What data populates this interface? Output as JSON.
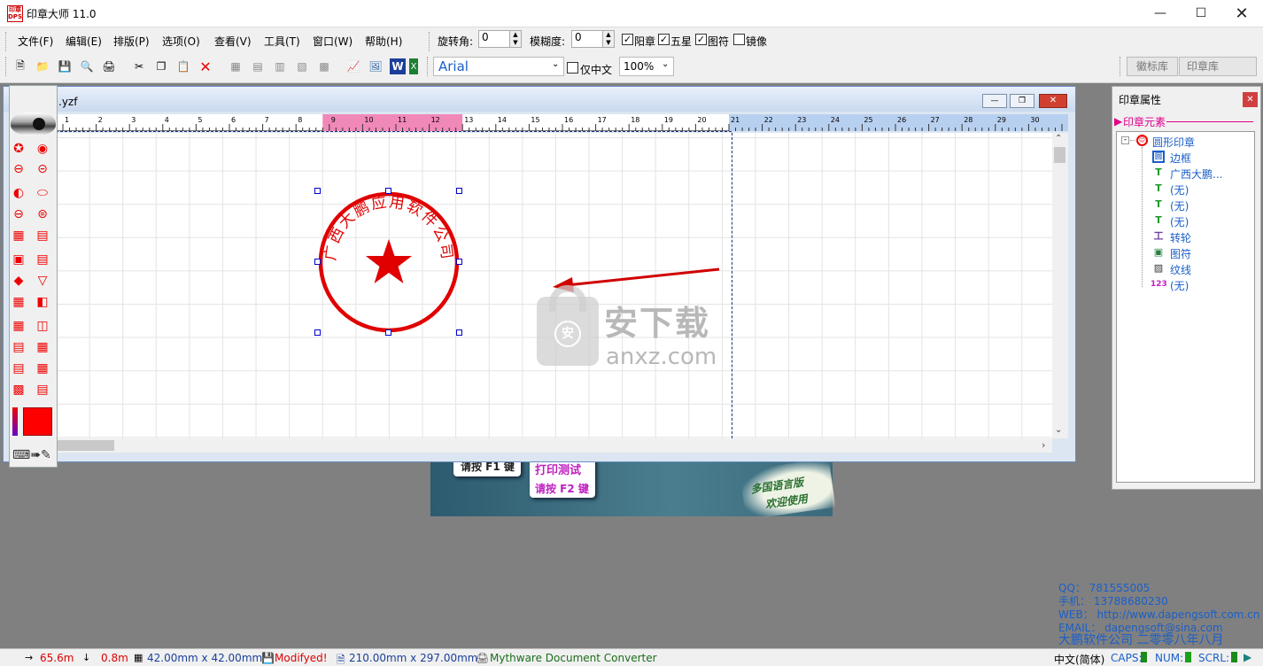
{
  "window": {
    "title": "印章大师 11.0",
    "app_icon_text": "印章\nDPS"
  },
  "menu": [
    "文件(F)",
    "编辑(E)",
    "排版(P)",
    "选项(O)",
    "查看(V)",
    "工具(T)",
    "窗口(W)",
    "帮助(H)"
  ],
  "rotation": {
    "label": "旋转角:",
    "value": "0"
  },
  "blur": {
    "label": "模糊度:",
    "value": "0"
  },
  "checks": [
    {
      "label": "阳章",
      "checked": true
    },
    {
      "label": "五星",
      "checked": true
    },
    {
      "label": "图符",
      "checked": true
    },
    {
      "label": "镜像",
      "checked": false
    }
  ],
  "font": {
    "value": "Arial"
  },
  "cn_only": {
    "label": "仅中文",
    "checked": false
  },
  "zoom": {
    "value": "100%"
  },
  "library_tabs": [
    "徽标库",
    "印章库"
  ],
  "document": {
    "filename": ".yzf"
  },
  "ruler": {
    "ticks": [
      "1",
      "2",
      "3",
      "4",
      "5",
      "6",
      "7",
      "8",
      "9",
      "10",
      "11",
      "12",
      "13",
      "14",
      "15",
      "16",
      "17",
      "18",
      "19",
      "20",
      "21",
      "22",
      "23",
      "24",
      "25",
      "26",
      "27",
      "28",
      "29",
      "30"
    ]
  },
  "seal": {
    "text": "广西大鹏应用软件公司",
    "color": "#e00000"
  },
  "watermark": {
    "cn": "安下载",
    "en": "anxz.com",
    "badge": "安"
  },
  "properties": {
    "title": "印章属性",
    "section": "印章元素",
    "tree": [
      {
        "icon": "seal-circle-icon",
        "label": "圆形印章"
      },
      {
        "icon": "border-icon",
        "label": "边框"
      },
      {
        "icon": "text-icon",
        "label": "广西大鹏..."
      },
      {
        "icon": "text2-icon",
        "label": "(无)"
      },
      {
        "icon": "text3-icon",
        "label": "(无)"
      },
      {
        "icon": "text4-icon",
        "label": "(无)"
      },
      {
        "icon": "wheel-icon",
        "label": "转轮"
      },
      {
        "icon": "image-icon",
        "label": "图符"
      },
      {
        "icon": "pattern-icon",
        "label": "纹线"
      },
      {
        "icon": "number-icon",
        "label": "(无)"
      }
    ],
    "icon_texts": [
      "回",
      "T",
      "T",
      "T",
      "T",
      "工",
      "▣",
      "▨",
      "123"
    ]
  },
  "banner": {
    "f1": "请按 F1 键",
    "print_test": "打印测试",
    "f2": "请按 F2 键",
    "lang1": "多国语言版",
    "lang2": "欢迎使用"
  },
  "contact": {
    "qq": "QQ： 781555005",
    "phone": "手机： 13788680230",
    "web": "WEB： http://www.dapengsoft.com.cn",
    "email": "EMAIL： dapengsoft@sina.com",
    "company": "大鹏软件公司 二零零八年八月"
  },
  "status": {
    "x": "65.6m",
    "y": "0.8m",
    "size": "42.00mm x 42.00mm",
    "modified": "Modifyed!",
    "paper": "210.00mm x 297.00mm",
    "printer": "Mythware Document Converter",
    "ime": "中文(简体)",
    "caps": "CAPS:",
    "num": "NUM:",
    "scrl": "SCRL:"
  },
  "colors": {
    "seal": "#e00000",
    "selected_ruler": "#f088b8",
    "ruler_right": "#b8d0f0",
    "link": "#1a5fc8"
  }
}
